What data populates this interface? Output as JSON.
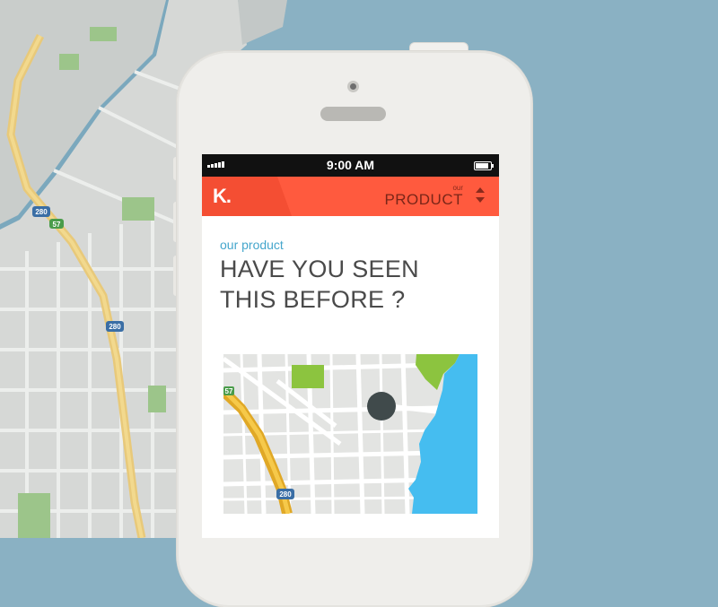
{
  "status_bar": {
    "time": "9:00 AM"
  },
  "app_bar": {
    "logo": "K.",
    "nav_small": "our",
    "nav_main": "PRODUCT"
  },
  "content": {
    "eyebrow": "our product",
    "headline": "HAVE YOU SEEN THIS BEFORE ?"
  },
  "colors": {
    "accent": "#ff5a3e",
    "water": "#45bdf0",
    "eyebrow": "#45a6cc",
    "marker": "#404a4b"
  },
  "map": {
    "highway_badges": [
      "280",
      "57"
    ]
  },
  "background_map": {
    "highway_badges": [
      "280",
      "57",
      "280"
    ]
  }
}
